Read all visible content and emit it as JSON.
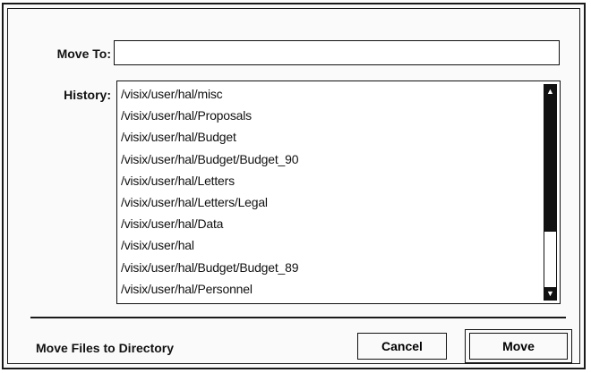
{
  "dialog": {
    "move_to": {
      "label": "Move To:",
      "value": ""
    },
    "history": {
      "label": "History:",
      "items": [
        "/visix/user/hal/misc",
        "/visix/user/hal/Proposals",
        "/visix/user/hal/Budget",
        "/visix/user/hal/Budget/Budget_90",
        "/visix/user/hal/Letters",
        "/visix/user/hal/Letters/Legal",
        "/visix/user/hal/Data",
        "/visix/user/hal",
        "/visix/user/hal/Budget/Budget_89",
        "/visix/user/hal/Personnel"
      ],
      "scroll_up_icon": "arrow-up-icon",
      "scroll_down_icon": "arrow-down-icon"
    },
    "status": "Move Files to Directory",
    "buttons": {
      "cancel": "Cancel",
      "move": "Move"
    }
  }
}
